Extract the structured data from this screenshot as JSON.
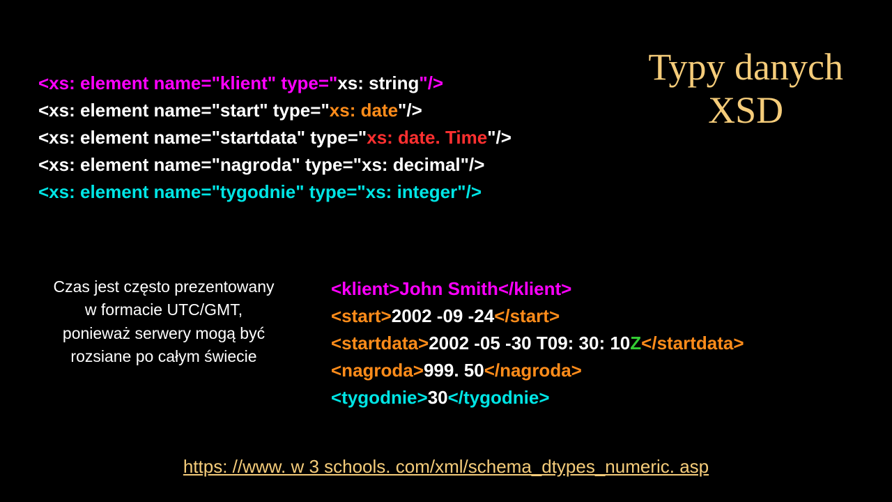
{
  "heading": {
    "line1": "Typy danych",
    "line2": "XSD"
  },
  "schema": {
    "lines": [
      {
        "name_attr": "klient",
        "name_color": "c-magenta",
        "type_attr": "xs: string",
        "type_color": "c-white"
      },
      {
        "name_attr": "start",
        "name_color": "c-white",
        "type_attr": "xs: date",
        "type_color": "c-orange"
      },
      {
        "name_attr": "startdata",
        "name_color": "c-white",
        "type_attr": "xs: date. Time",
        "type_color": "c-red"
      },
      {
        "name_attr": "nagroda",
        "name_color": "c-white",
        "type_attr": "xs: decimal",
        "type_color": "c-white"
      },
      {
        "name_attr": "tygodnie",
        "name_color": "c-cyan",
        "type_attr": "xs: integer",
        "type_color": "c-cyan"
      }
    ],
    "prefix": "<xs: element name=\"",
    "mid": "\" type=\"",
    "suffix": "\"/>"
  },
  "note": {
    "l1": "Czas jest często prezentowany",
    "l2": "w formacie UTC/GMT,",
    "l3": "ponieważ serwery mogą być",
    "l4": "rozsiane po całym świecie"
  },
  "examples": {
    "lines": [
      {
        "tag": "klient",
        "tag_color": "c-magenta",
        "value": "John Smith",
        "val_color": "c-magenta",
        "extra": "",
        "extra_color": ""
      },
      {
        "tag": "start",
        "tag_color": "c-orange",
        "value": "2002 -09 -24",
        "val_color": "c-white",
        "extra": "",
        "extra_color": ""
      },
      {
        "tag": "startdata",
        "tag_color": "c-orange",
        "value": "2002 -05 -30 T09: 30: 10",
        "val_color": "c-white",
        "extra": "Z",
        "extra_color": "c-green"
      },
      {
        "tag": "nagroda",
        "tag_color": "c-orange",
        "value": "999. 50",
        "val_color": "c-white",
        "extra": "",
        "extra_color": ""
      },
      {
        "tag": "tygodnie",
        "tag_color": "c-cyan",
        "value": "30",
        "val_color": "c-white",
        "extra": "",
        "extra_color": ""
      }
    ]
  },
  "link": {
    "text": "https: //www. w 3 schools. com/xml/schema_dtypes_numeric. asp",
    "href": "https://www.w3schools.com/xml/schema_dtypes_numeric.asp"
  }
}
